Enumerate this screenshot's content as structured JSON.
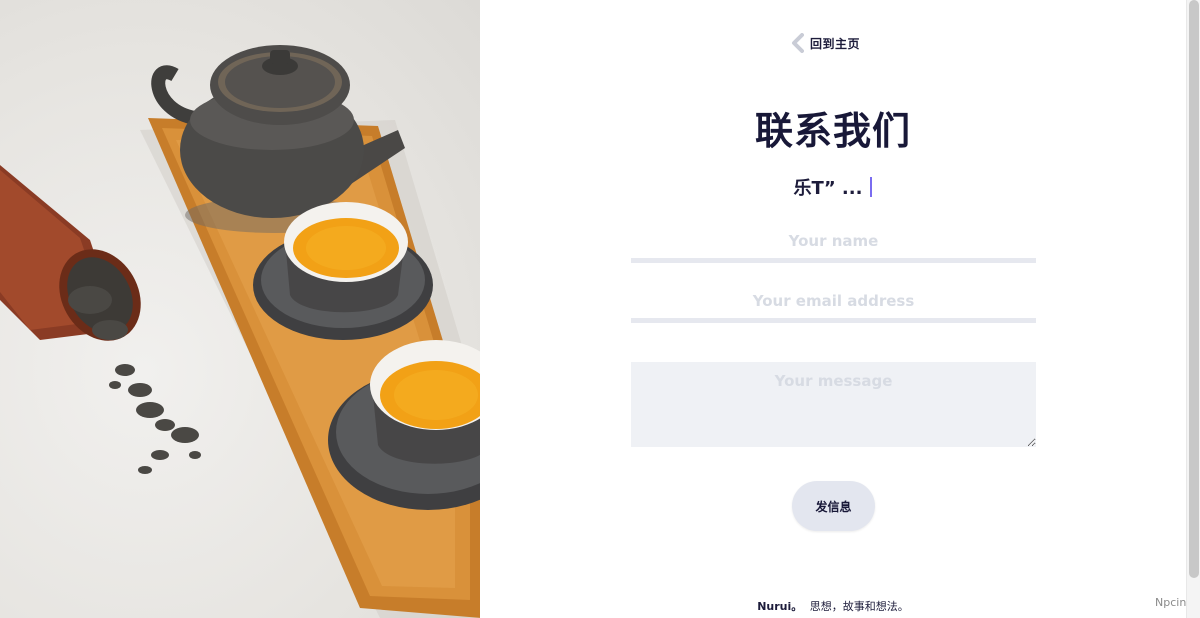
{
  "nav": {
    "back_label": "回到主页"
  },
  "page": {
    "title": "联系我们",
    "typing_text": "乐T” ..."
  },
  "form": {
    "name_placeholder": "Your name",
    "email_placeholder": "Your email address",
    "message_placeholder": "Your message",
    "send_label": "发信息"
  },
  "footer": {
    "brand": "Nurui。",
    "tagline": "思想，故事和想法。"
  },
  "watermark": "Npcink",
  "colors": {
    "accent_caret": "#7a6cf0",
    "title": "#181838",
    "button_bg": "#e3e6ef",
    "field_underline": "#e6e8ef"
  },
  "icons": {
    "back": "chevron-left-icon"
  }
}
